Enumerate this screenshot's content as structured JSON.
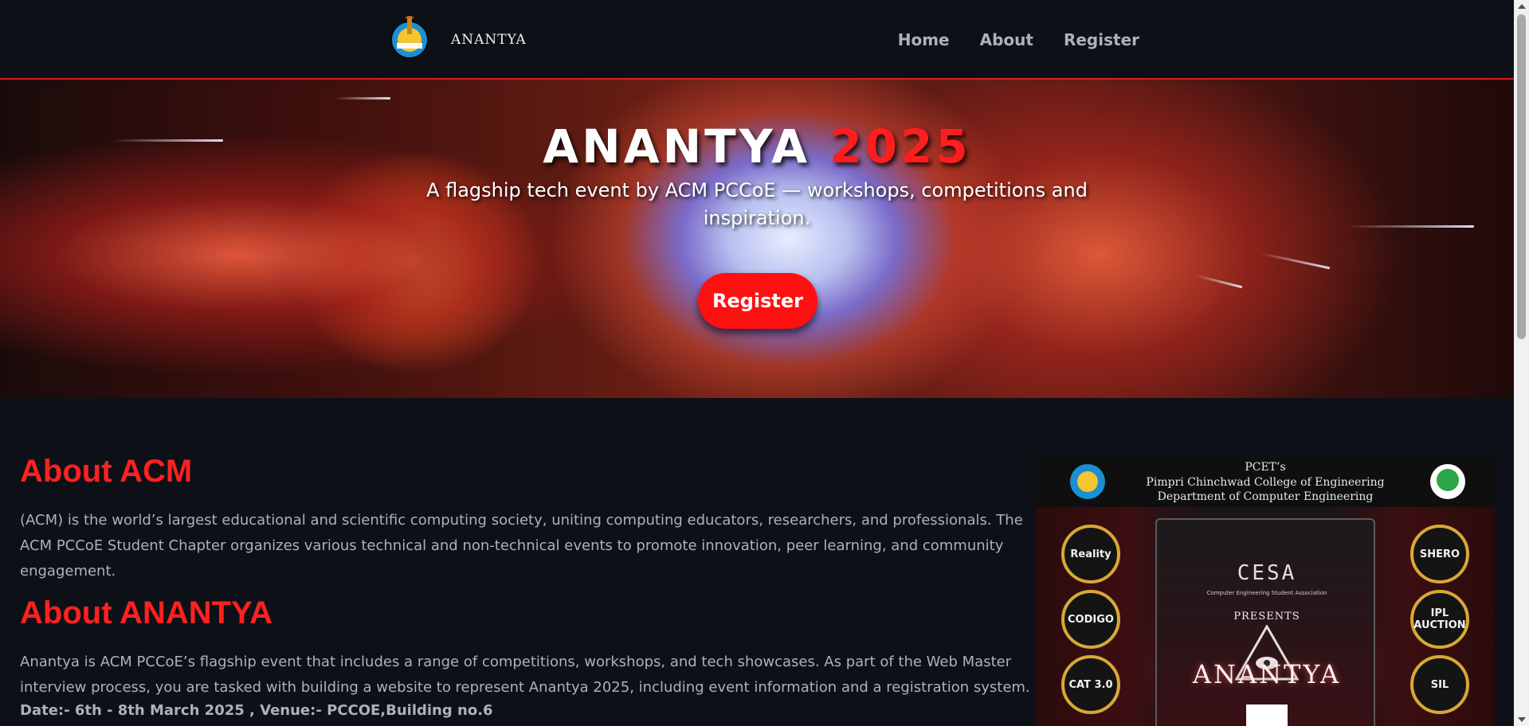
{
  "navbar": {
    "logo_text": "ANANTYA",
    "links": [
      "Home",
      "About",
      "Register"
    ]
  },
  "hero": {
    "title_main": "ANANTYA",
    "title_year": "2025",
    "subtitle": "A flagship tech event by ACM PCCoE — workshops, competitions and inspiration.",
    "register_label": "Register"
  },
  "about_acm": {
    "heading": "About ACM",
    "body": "(ACM) is the world’s largest educational and scientific computing society, uniting computing educators, researchers, and professionals. The ACM PCCoE Student Chapter organizes various technical and non-technical events to promote innovation, peer learning, and community engagement."
  },
  "about_anantya": {
    "heading": "About ANANTYA",
    "body": "Anantya is ACM PCCoE’s flagship event that includes a range of competitions, workshops, and tech showcases. As part of the Web Master interview process, you are tasked with building a website to represent Anantya 2025, including event information and a registration system.",
    "date_venue": "Date:- 6th - 8th March 2025 , Venue:- PCCOE,Building no.6"
  },
  "poster": {
    "header_line1": "PCET’s",
    "header_line2": "Pimpri Chinchwad College of Engineering",
    "header_line3": "Department of Computer Engineering",
    "cesa": "CESA",
    "cesa_sub": "Computer Engineering Student Association",
    "presents": "PRESENTS",
    "title": "ANANTYA",
    "badges_left": [
      "Reality",
      "CODIGO",
      "CAT 3.0"
    ],
    "badges_right": [
      "SHERO",
      "IPL AUCTION",
      "SIL"
    ]
  },
  "colors": {
    "accent": "#ff1e1e",
    "background": "#0d1117",
    "text": "#aab2bd"
  }
}
